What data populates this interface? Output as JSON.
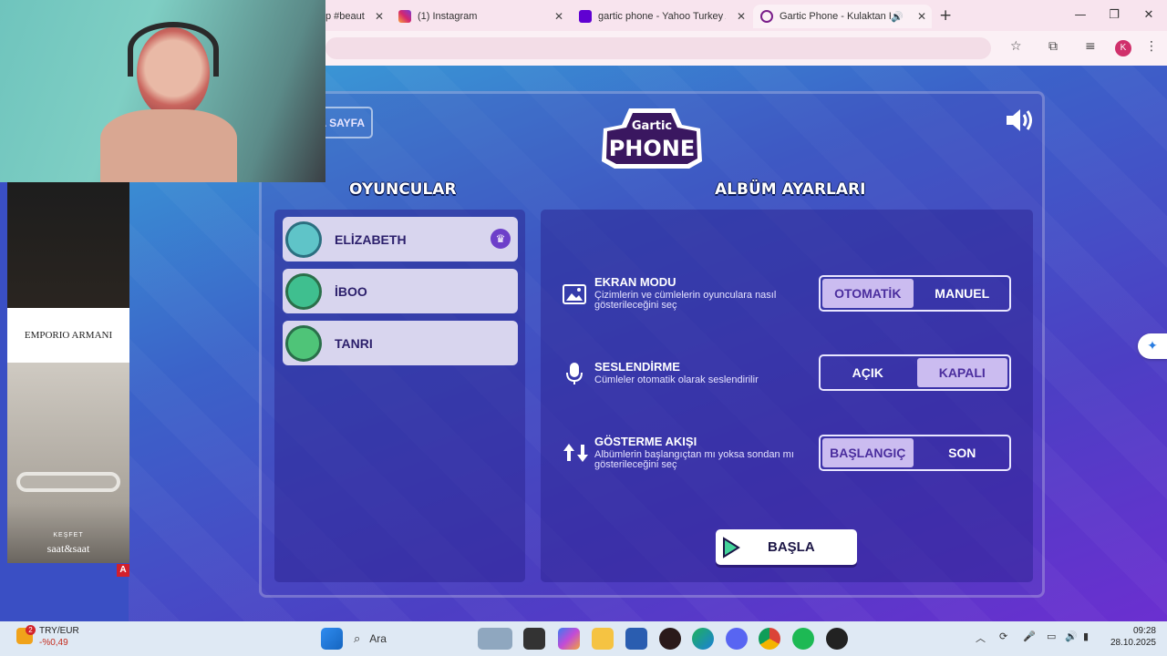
{
  "browser": {
    "tabs": [
      {
        "label": "p #beaut",
        "icon": "music-icon",
        "active": false
      },
      {
        "label": "(1) Instagram",
        "icon": "instagram-icon",
        "active": false
      },
      {
        "label": "gartic phone - Yahoo Turkey Ar",
        "icon": "yahoo-icon",
        "active": false
      },
      {
        "label": "Gartic Phone - Kulaktan Kul",
        "icon": "gartic-icon",
        "active": true
      }
    ],
    "new_tab": "+",
    "profile_initial": "K",
    "window_controls": {
      "minimize": "—",
      "restore": "❐",
      "close": "✕"
    }
  },
  "game": {
    "back_label": "A SAYFA",
    "logo_top": "Gartic",
    "logo_bottom": "PHONE",
    "players_title": "OYUNCULAR",
    "settings_title": "ALBÜM AYARLARI",
    "players": [
      {
        "name": "ELİZABETH",
        "host": true,
        "avatar_color": "#5fc4c8"
      },
      {
        "name": "İBOO",
        "host": false,
        "avatar_color": "#3fbf8f"
      },
      {
        "name": "TANRI",
        "host": false,
        "avatar_color": "#4fc478"
      }
    ],
    "settings": [
      {
        "title": "EKRAN MODU",
        "desc": "Çizimlerin ve cümlelerin oyunculara nasıl gösterileceğini seç",
        "icon": "image-icon",
        "options": [
          "OTOMATİK",
          "MANUEL"
        ],
        "selected": 0
      },
      {
        "title": "SESLENDİRME",
        "desc": "Cümleler otomatik olarak seslendirilir",
        "icon": "microphone-icon",
        "options": [
          "AÇIK",
          "KAPALI"
        ],
        "selected": 1
      },
      {
        "title": "GÖSTERME AKIŞI",
        "desc": "Albümlerin başlangıçtan mı yoksa sondan mı gösterileceğini seç",
        "icon": "up-down-arrows-icon",
        "options": [
          "BAŞLANGIÇ",
          "SON"
        ],
        "selected": 0
      }
    ],
    "start_label": "BAŞLA"
  },
  "ad": {
    "brand": "EMPORIO ARMANI",
    "cta_small": "KEŞFET",
    "cta_brand": "saat&saat",
    "badge": "A"
  },
  "taskbar": {
    "weather_line1": "TRY/EUR",
    "weather_line2": "-%0,49",
    "notif_count": "2",
    "search_label": "Ara",
    "time": "09:28",
    "date": "28.10.2025"
  }
}
